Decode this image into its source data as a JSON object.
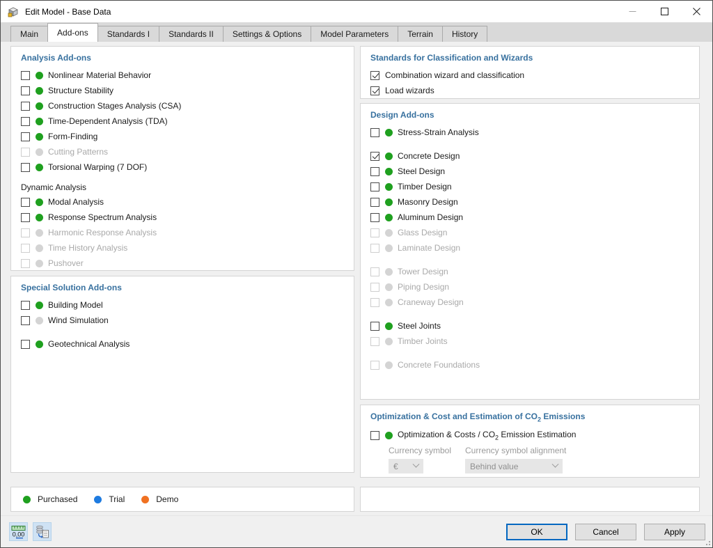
{
  "window": {
    "title": "Edit Model - Base Data"
  },
  "tabs": [
    {
      "label": "Main"
    },
    {
      "label": "Add-ons"
    },
    {
      "label": "Standards I"
    },
    {
      "label": "Standards II"
    },
    {
      "label": "Settings & Options"
    },
    {
      "label": "Model Parameters"
    },
    {
      "label": "Terrain"
    },
    {
      "label": "History"
    }
  ],
  "active_tab": "Add-ons",
  "colors": {
    "heading": "#38719f",
    "purchased": "#1fa01f",
    "trial": "#1e7be0",
    "demo": "#f07121",
    "disabled_text": "#a9a9a9",
    "ok_button_border": "#0067c0"
  },
  "left": {
    "analysis": {
      "heading": "Analysis Add-ons",
      "items": [
        {
          "label": "Nonlinear Material Behavior",
          "status": "purchased",
          "checked": false,
          "disabled": false
        },
        {
          "label": "Structure Stability",
          "status": "purchased",
          "checked": false,
          "disabled": false
        },
        {
          "label": "Construction Stages Analysis (CSA)",
          "status": "purchased",
          "checked": false,
          "disabled": false
        },
        {
          "label": "Time-Dependent Analysis (TDA)",
          "status": "purchased",
          "checked": false,
          "disabled": false
        },
        {
          "label": "Form-Finding",
          "status": "purchased",
          "checked": false,
          "disabled": false
        },
        {
          "label": "Cutting Patterns",
          "status": "none",
          "checked": false,
          "disabled": true
        },
        {
          "label": "Torsional Warping (7 DOF)",
          "status": "purchased",
          "checked": false,
          "disabled": false
        }
      ]
    },
    "dynamic": {
      "heading": "Dynamic Analysis",
      "items": [
        {
          "label": "Modal Analysis",
          "status": "purchased",
          "checked": false,
          "disabled": false
        },
        {
          "label": "Response Spectrum Analysis",
          "status": "purchased",
          "checked": false,
          "disabled": false
        },
        {
          "label": "Harmonic Response Analysis",
          "status": "none",
          "checked": false,
          "disabled": true
        },
        {
          "label": "Time History Analysis",
          "status": "none",
          "checked": false,
          "disabled": true
        },
        {
          "label": "Pushover",
          "status": "none",
          "checked": false,
          "disabled": true
        }
      ]
    },
    "special": {
      "heading": "Special Solution Add-ons",
      "items": [
        {
          "label": "Building Model",
          "status": "purchased",
          "checked": false,
          "disabled": false
        },
        {
          "label": "Wind Simulation",
          "status": "none",
          "checked": false,
          "disabled": false
        },
        {
          "label": "Geotechnical Analysis",
          "status": "purchased",
          "checked": false,
          "disabled": false
        }
      ]
    },
    "legend": {
      "items": [
        {
          "label": "Purchased",
          "color": "#1fa01f"
        },
        {
          "label": "Trial",
          "color": "#1e7be0"
        },
        {
          "label": "Demo",
          "color": "#f07121"
        }
      ]
    }
  },
  "right": {
    "standards": {
      "heading": "Standards for Classification and Wizards",
      "items": [
        {
          "label": "Combination wizard and classification",
          "checked": true
        },
        {
          "label": "Load wizards",
          "checked": true
        }
      ]
    },
    "design": {
      "heading": "Design Add-ons",
      "items": [
        {
          "label": "Stress-Strain Analysis",
          "status": "purchased",
          "checked": false,
          "disabled": false
        },
        {
          "label": "Concrete Design",
          "status": "purchased",
          "checked": true,
          "disabled": false
        },
        {
          "label": "Steel Design",
          "status": "purchased",
          "checked": false,
          "disabled": false
        },
        {
          "label": "Timber Design",
          "status": "purchased",
          "checked": false,
          "disabled": false
        },
        {
          "label": "Masonry Design",
          "status": "purchased",
          "checked": false,
          "disabled": false
        },
        {
          "label": "Aluminum Design",
          "status": "purchased",
          "checked": false,
          "disabled": false
        },
        {
          "label": "Glass Design",
          "status": "none",
          "checked": false,
          "disabled": true
        },
        {
          "label": "Laminate Design",
          "status": "none",
          "checked": false,
          "disabled": true
        },
        {
          "label": "Tower Design",
          "status": "none",
          "checked": false,
          "disabled": true
        },
        {
          "label": "Piping Design",
          "status": "none",
          "checked": false,
          "disabled": true
        },
        {
          "label": "Craneway Design",
          "status": "none",
          "checked": false,
          "disabled": true
        },
        {
          "label": "Steel Joints",
          "status": "purchased",
          "checked": false,
          "disabled": false
        },
        {
          "label": "Timber Joints",
          "status": "none",
          "checked": false,
          "disabled": true
        },
        {
          "label": "Concrete Foundations",
          "status": "none",
          "checked": false,
          "disabled": true
        }
      ]
    },
    "optimization": {
      "heading_pre": "Optimization & Cost and Estimation of CO",
      "heading_sub": "2",
      "heading_post": " Emissions",
      "item": {
        "label_pre": "Optimization & Costs / CO",
        "label_sub": "2",
        "label_post": " Emission Estimation",
        "status": "purchased",
        "checked": false
      },
      "currency_symbol": {
        "label": "Currency symbol",
        "value": "€"
      },
      "currency_alignment": {
        "label": "Currency symbol alignment",
        "value": "Behind value"
      }
    }
  },
  "footer": {
    "units_icon_label": "0,00",
    "ok": "OK",
    "cancel": "Cancel",
    "apply": "Apply"
  }
}
